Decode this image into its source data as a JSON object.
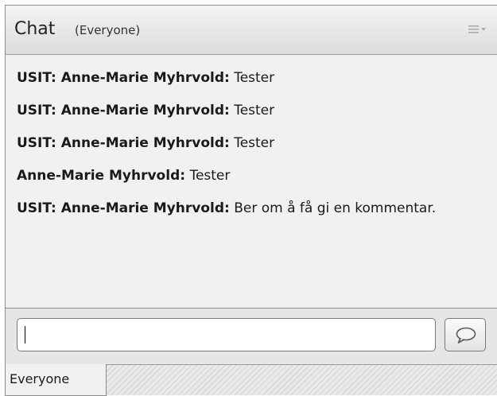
{
  "header": {
    "title": "Chat",
    "scope": "(Everyone)",
    "menu_icon": "pod-menu-icon"
  },
  "messages": [
    {
      "sender": "USIT: Anne-Marie Myhrvold:",
      "text": " Tester"
    },
    {
      "sender": "USIT: Anne-Marie Myhrvold:",
      "text": " Tester"
    },
    {
      "sender": "USIT: Anne-Marie Myhrvold:",
      "text": " Tester"
    },
    {
      "sender": "Anne-Marie Myhrvold:",
      "text": " Tester"
    },
    {
      "sender": "USIT: Anne-Marie Myhrvold:",
      "text": " Ber om å få gi en kommentar."
    }
  ],
  "input": {
    "value": "",
    "placeholder": ""
  },
  "send_icon": "speech-bubble-icon",
  "tabs": [
    {
      "label": "Everyone"
    }
  ]
}
